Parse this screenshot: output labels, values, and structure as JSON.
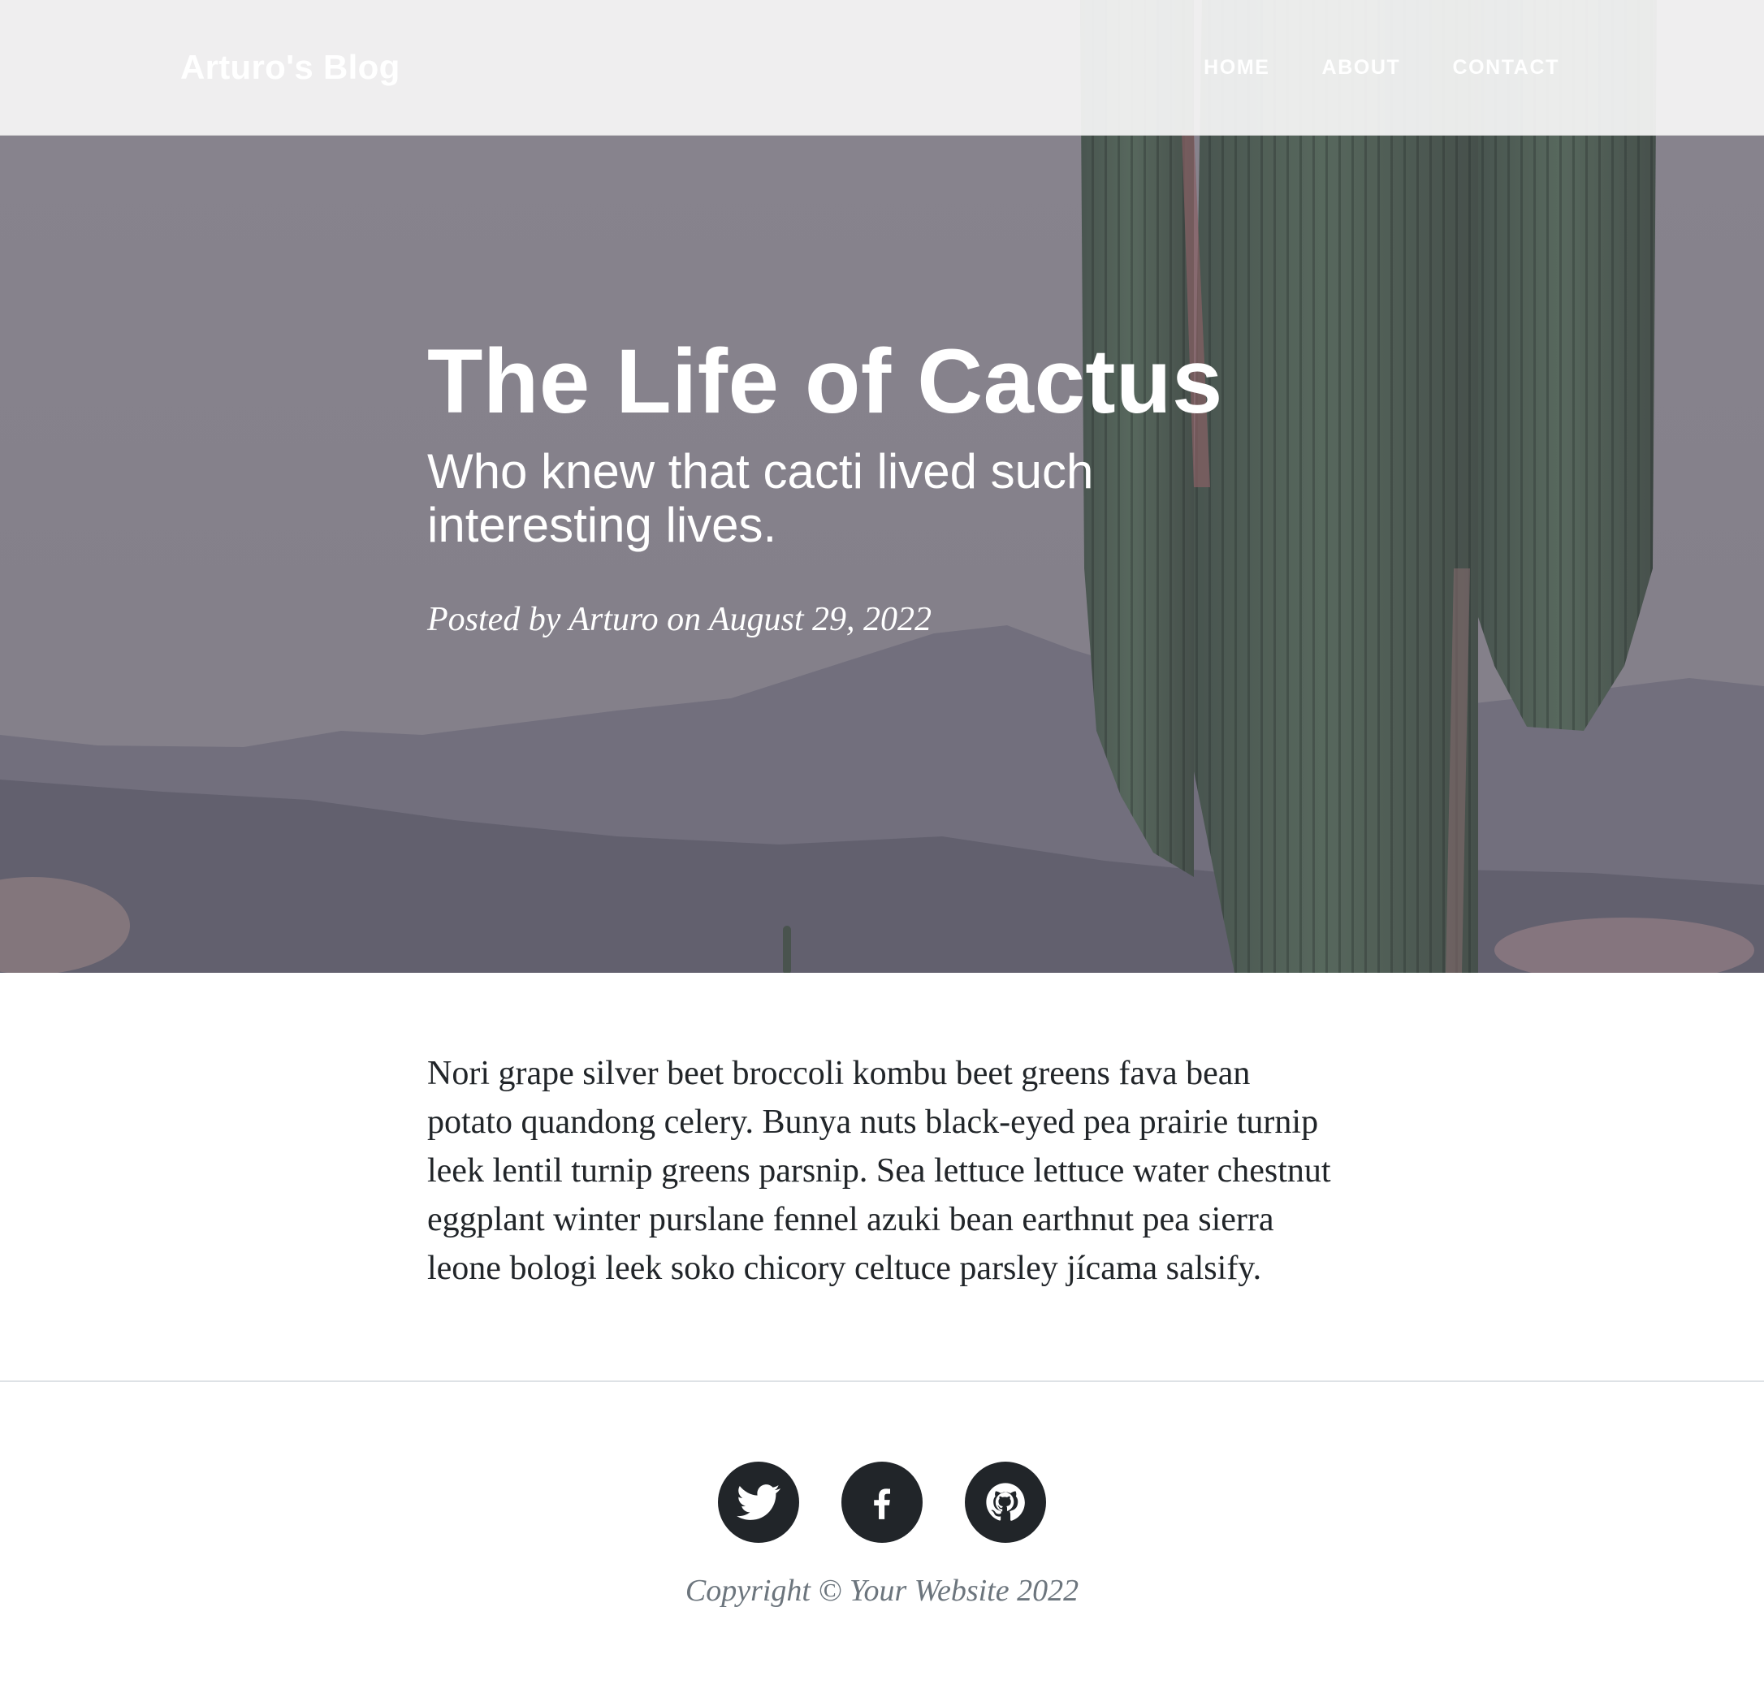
{
  "nav": {
    "brand": "Arturo's Blog",
    "links": [
      "Home",
      "About",
      "Contact"
    ]
  },
  "post": {
    "title": "The Life of Cactus",
    "subtitle": "Who knew that cacti lived such interesting lives.",
    "meta": "Posted by Arturo on August 29, 2022",
    "body": "Nori grape silver beet broccoli kombu beet greens fava bean potato quandong celery. Bunya nuts black-eyed pea prairie turnip leek lentil turnip greens parsnip. Sea lettuce lettuce water chestnut eggplant winter purslane fennel azuki bean earthnut pea sierra leone bologi leek soko chicory celtuce parsley jícama salsify."
  },
  "footer": {
    "socials": [
      "twitter-icon",
      "facebook-icon",
      "github-icon"
    ],
    "copyright": "Copyright © Your Website 2022"
  },
  "colors": {
    "hero_overlay": "#858089",
    "footer_icon_bg": "#212529",
    "copyright_text": "#6c757d"
  }
}
